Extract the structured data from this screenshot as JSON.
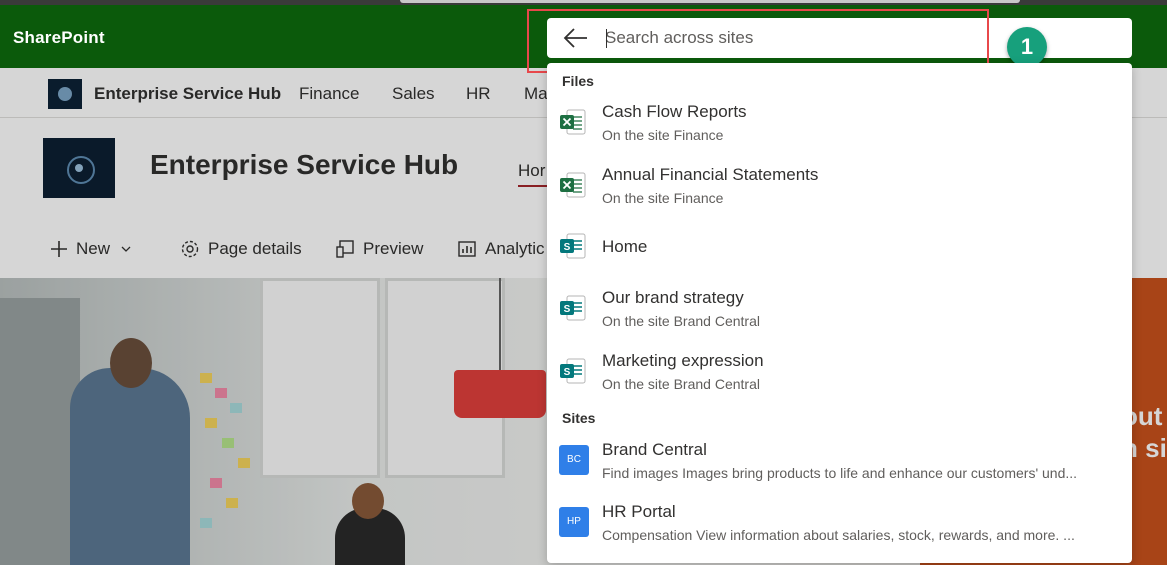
{
  "app": {
    "brand": "SharePoint",
    "suite_bar_color": "#0b5a0b",
    "accent_color": "#a4262c"
  },
  "search": {
    "placeholder": "Search across sites",
    "value": "",
    "back_icon": "arrow-left-icon"
  },
  "annotation": {
    "step_number": "1",
    "badge_color": "#17a07c",
    "highlight_color": "#e8484b"
  },
  "hub_nav": {
    "title": "Enterprise Service Hub",
    "links": [
      "Finance",
      "Sales",
      "HR",
      "Ma"
    ]
  },
  "site": {
    "title": "Enterprise Service Hub",
    "nav_home": "Hor"
  },
  "command_bar": {
    "new": "New",
    "page_details": "Page details",
    "preview": "Preview",
    "analytics": "Analytic"
  },
  "hero": {
    "right_text_line1": "out",
    "right_text_line2": "n sit"
  },
  "dropdown": {
    "files_label": "Files",
    "files": [
      {
        "title": "Cash Flow Reports",
        "subtitle": "On the site Finance",
        "icon": "excel-icon"
      },
      {
        "title": "Annual Financial Statements",
        "subtitle": "On the site Finance",
        "icon": "excel-icon"
      },
      {
        "title": "Home",
        "subtitle": "",
        "icon": "sharepoint-page-icon"
      },
      {
        "title": "Our brand strategy",
        "subtitle": "On the site Brand Central",
        "icon": "sharepoint-page-icon"
      },
      {
        "title": "Marketing expression",
        "subtitle": "On the site Brand Central",
        "icon": "sharepoint-page-icon"
      }
    ],
    "sites_label": "Sites",
    "sites": [
      {
        "initials": "BC",
        "title": "Brand Central",
        "subtitle": "Find images Images bring products to life and enhance our customers' und..."
      },
      {
        "initials": "HP",
        "title": "HR Portal",
        "subtitle": "Compensation View information about salaries, stock, rewards, and more. ..."
      }
    ]
  }
}
